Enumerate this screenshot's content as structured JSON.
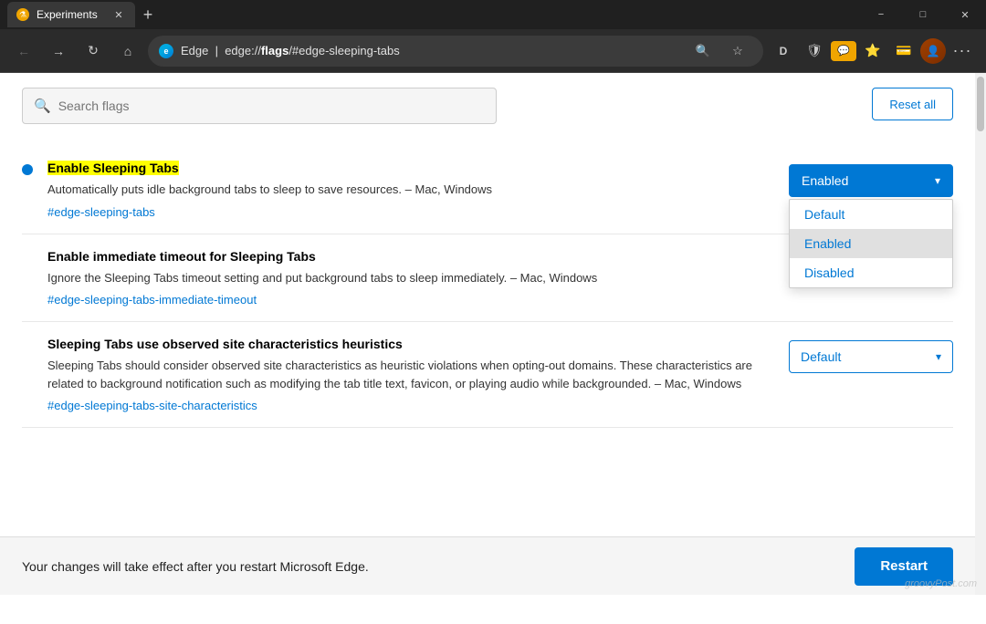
{
  "titlebar": {
    "tab_label": "Experiments",
    "new_tab_label": "+",
    "minimize": "−",
    "restore": "□",
    "close": "✕"
  },
  "toolbar": {
    "back_title": "Back",
    "forward_title": "Forward",
    "refresh_title": "Refresh",
    "home_title": "Home",
    "address_brand": "Edge",
    "address_prefix": "edge://",
    "address_bold": "flags",
    "address_hash": "/#edge-sleeping-tabs",
    "search_title": "Search",
    "favorites_title": "Favorites",
    "menu_title": "More"
  },
  "search": {
    "placeholder": "Search flags",
    "reset_label": "Reset all"
  },
  "flags": [
    {
      "id": "enable-sleeping-tabs",
      "title": "Enable Sleeping Tabs",
      "highlighted": true,
      "dot": true,
      "desc": "Automatically puts idle background tabs to sleep to save resources. – Mac, Windows",
      "link": "#edge-sleeping-tabs",
      "control_state": "enabled",
      "dropdown_open": true,
      "options": [
        "Default",
        "Enabled",
        "Disabled"
      ]
    },
    {
      "id": "enable-immediate-timeout",
      "title": "Enable immediate timeout for Sleeping Tabs",
      "highlighted": false,
      "dot": false,
      "desc": "Ignore the Sleeping Tabs timeout setting and put background tabs to sleep immediately. – Mac, Windows",
      "link": "#edge-sleeping-tabs-immediate-timeout",
      "control_state": "default",
      "dropdown_open": false,
      "options": [
        "Default",
        "Enabled",
        "Disabled"
      ]
    },
    {
      "id": "sleeping-tabs-site-characteristics",
      "title": "Sleeping Tabs use observed site characteristics heuristics",
      "highlighted": false,
      "dot": false,
      "desc": "Sleeping Tabs should consider observed site characteristics as heuristic violations when opting-out domains. These characteristics are related to background notification such as modifying the tab title text, favicon, or playing audio while backgrounded. – Mac, Windows",
      "link": "#edge-sleeping-tabs-site-characteristics",
      "control_state": "default",
      "dropdown_open": false,
      "options": [
        "Default",
        "Enabled",
        "Disabled"
      ]
    }
  ],
  "bottom": {
    "message": "Your changes will take effect after you restart Microsoft Edge.",
    "restart_label": "Restart"
  },
  "dropdown_open_options": {
    "default": "Default",
    "enabled": "Enabled",
    "disabled": "Disabled"
  }
}
